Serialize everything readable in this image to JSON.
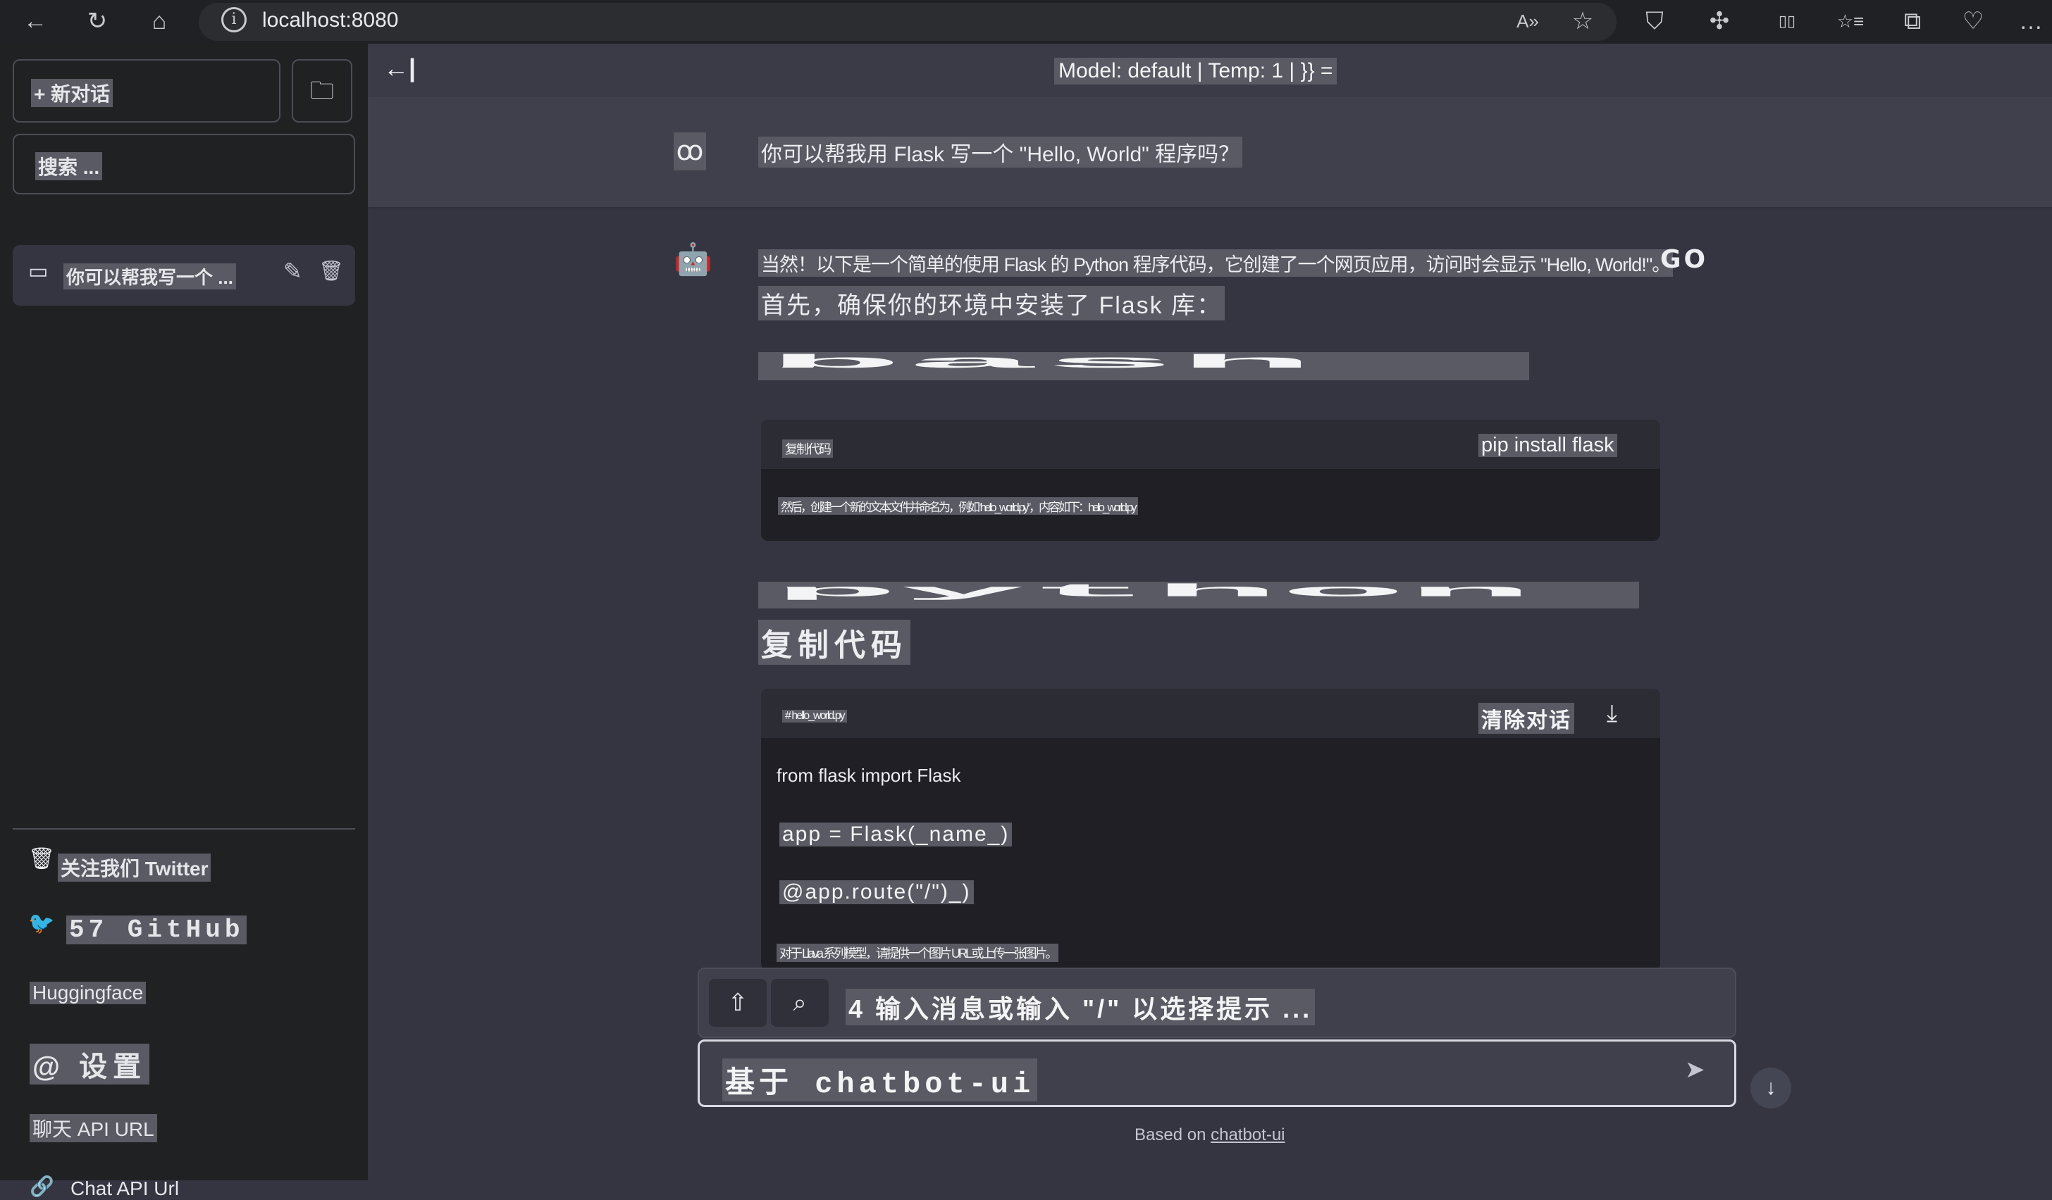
{
  "browser": {
    "url": "localhost:8080",
    "back_icon": "←",
    "reload_icon": "↻",
    "home_icon": "⌂",
    "info_icon": "i",
    "read_aloud_icon": "A»",
    "star_icon": "☆",
    "shield_icon": "⛉",
    "extensions_icon": "✣",
    "split_icon": "▯▯",
    "favorites_icon": "☆≡",
    "collections_icon": "⧉",
    "health_icon": "♡",
    "more_icon": "…"
  },
  "sidebar": {
    "new_chat_label": "+ 新对话",
    "new_folder_icon": "🗀",
    "search_placeholder": "搜索 ...",
    "conversations": [
      {
        "title": "你可以帮我写一个 ...",
        "chat_icon": "▭",
        "edit_icon": "✎",
        "delete_icon": "🗑"
      }
    ],
    "footer": {
      "item1_icon": "🗑",
      "item1_label": "关注我们 Twitter",
      "item2_icon": "🐦",
      "item2_label": "57 GitHub",
      "item3_label": "Huggingface",
      "item4_label": "@ 设置",
      "item5_label": "聊天 API URL",
      "item6_icon": "🔗",
      "item6_label": "Chat API Url"
    }
  },
  "topbar": {
    "collapse_icon": "←|",
    "model_info": "Model: default | Temp: 1 | }} ="
  },
  "messages": {
    "user": {
      "avatar_icon": "ꝏ",
      "text": "你可以帮我用 Flask 写一个 \"Hello, World\" 程序吗？"
    },
    "assistant": {
      "avatar_icon": "🤖",
      "line1": "当然！以下是一个简单的使用 Flask 的 Python 程序代码，它创建了一个网页应用，访问时会显示 \"Hello, World!\"。",
      "go_label": "GO",
      "line2": "首先，确保你的环境中安装了 Flask 库：",
      "bash_label": "bash",
      "code1": {
        "copy_label": "复制代码",
        "command": "pip install flask",
        "body": "然后，创建一个新的文本文件并命名为，例如“hello_world.py”，内容如下：hello_world.py"
      },
      "python_label": "python",
      "copy_code_label": "复制代码",
      "code2": {
        "filename": "# hello_world.py",
        "clear_label": "清除对话",
        "download_icon": "⤓",
        "line1": "from flask import Flask",
        "line2": "app = Flask(_name_)",
        "line3": "@app.route(\"/\")_)",
        "line4": "对于 Llava 系列模型，请提供一个图片 URL 或上传一张图片。"
      }
    }
  },
  "input": {
    "upload_icon": "⇧",
    "prompt_icon": "⌕",
    "hint": "4 输入消息或输入 \"/\" 以选择提示 ...",
    "value": "基于 chatbot-ui",
    "send_icon": "➤",
    "scroll_down_icon": "↓"
  },
  "footer": {
    "based_on": "Based on",
    "link": "chatbot-ui"
  }
}
